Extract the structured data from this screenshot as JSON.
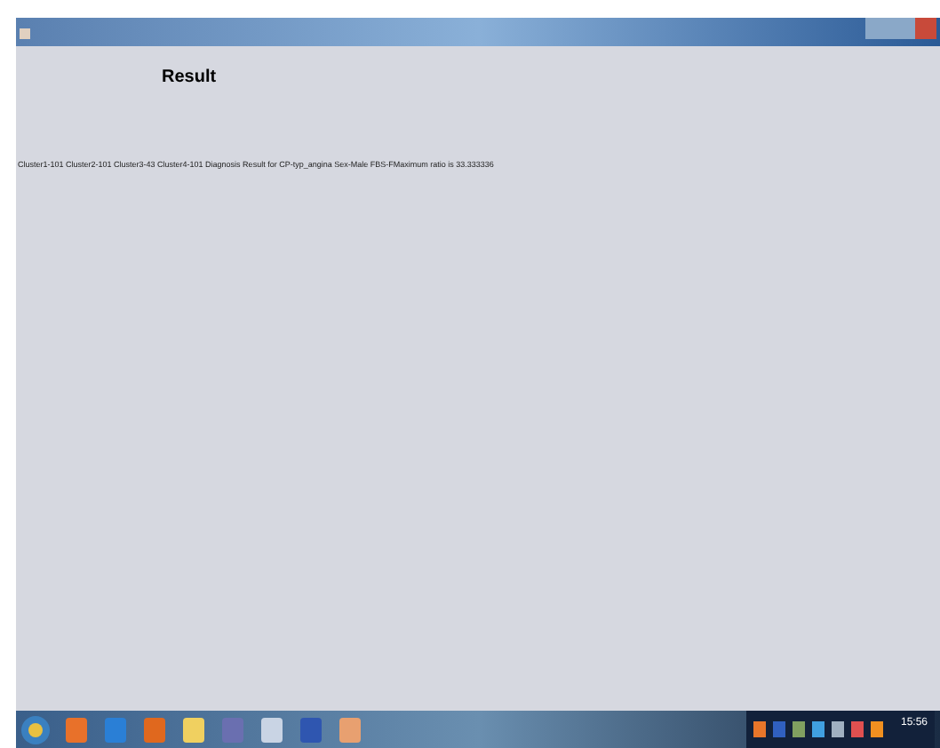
{
  "window": {
    "heading": "Result",
    "result_line": "Cluster1-101 Cluster2-101 Cluster3-43 Cluster4-101 Diagnosis Result for CP-typ_angina Sex-Male FBS-FMaximum ratio is 33.333336"
  },
  "taskbar": {
    "clock": "15:56"
  }
}
